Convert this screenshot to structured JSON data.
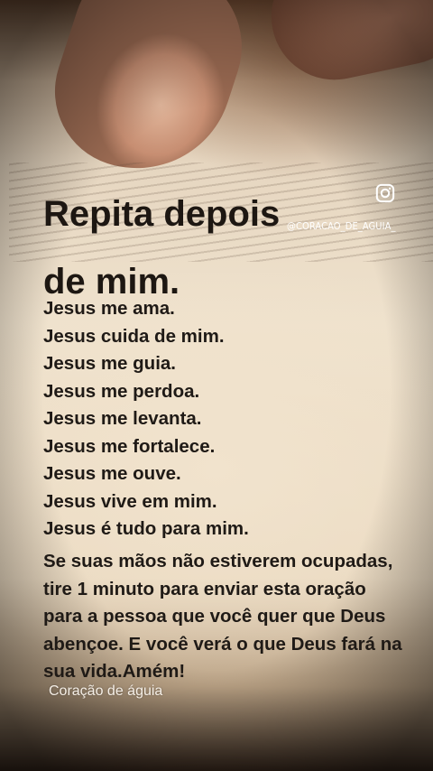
{
  "title": {
    "line1": "Repita depois",
    "line2": "de mim."
  },
  "instagram": {
    "icon": "instagram-icon",
    "handle": "@CORACAO_DE_AGUIA_"
  },
  "lines": [
    "Jesus me ama.",
    "Jesus cuida de mim.",
    "Jesus me guia.",
    "Jesus me perdoa.",
    "Jesus me levanta.",
    "Jesus me fortalece.",
    "Jesus me ouve.",
    "Jesus vive em mim.",
    "Jesus é tudo para mim."
  ],
  "message": "Se suas mãos não estiverem ocupadas, tire 1 minuto para enviar esta oração para a pessoa que você quer que Deus abençoe. E você verá o que Deus fará na sua vida.Amém!",
  "watermark": "Coração de águia",
  "colors": {
    "text": "#1f1a16",
    "watermark": "#f4eee6"
  }
}
